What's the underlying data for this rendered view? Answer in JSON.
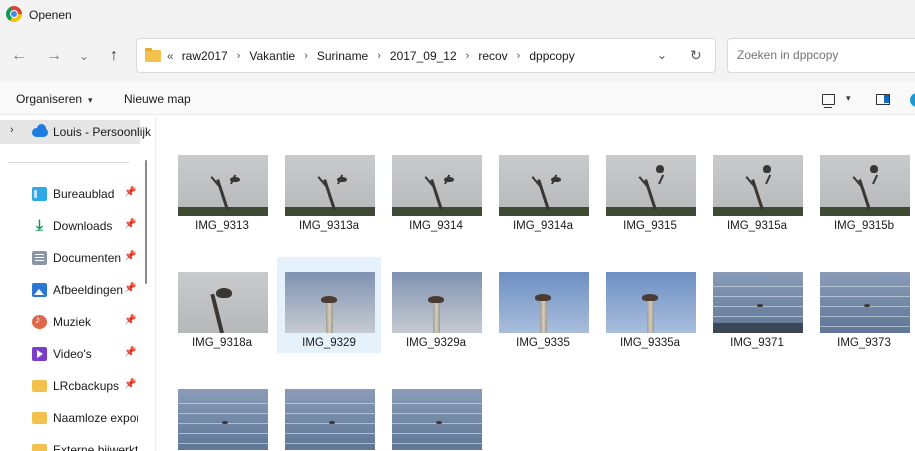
{
  "window": {
    "title": "Openen"
  },
  "nav": {
    "back_icon": "←",
    "forward_icon": "→",
    "recent_icon": "⌄",
    "up_icon": "↑"
  },
  "address": {
    "overflow": "«",
    "crumbs": [
      "raw2017",
      "Vakantie",
      "Suriname",
      "2017_09_12",
      "recov",
      "dppcopy"
    ],
    "separator": "›",
    "chevron": "⌄",
    "refresh": "↻"
  },
  "search": {
    "placeholder": "Zoeken in dppcopy"
  },
  "toolbar": {
    "organize_label": "Organiseren",
    "organize_arrow": "▾",
    "new_folder_label": "Nieuwe map",
    "view_arrow": "▾"
  },
  "sidebar": {
    "onedrive_label": "Louis - Persoonlijk",
    "chevron": "›",
    "pin": "📌",
    "items": [
      {
        "label": "Bureaublad",
        "icon": "desktop-icon",
        "pinned": true
      },
      {
        "label": "Downloads",
        "icon": "download-icon",
        "glyph": "⤓",
        "pinned": true
      },
      {
        "label": "Documenten",
        "icon": "documents-icon",
        "pinned": true
      },
      {
        "label": "Afbeeldingen",
        "icon": "pictures-icon",
        "pinned": true
      },
      {
        "label": "Muziek",
        "icon": "music-icon",
        "pinned": true
      },
      {
        "label": "Video's",
        "icon": "video-icon",
        "pinned": true
      },
      {
        "label": "LRcbackups",
        "icon": "folder-icon",
        "pinned": true
      },
      {
        "label": "Naamloze export",
        "icon": "folder-icon",
        "pinned": false
      },
      {
        "label": "Externe bijwerkt",
        "icon": "folder-icon",
        "pinned": false
      }
    ]
  },
  "files": [
    {
      "name": "IMG_9313"
    },
    {
      "name": "IMG_9313a"
    },
    {
      "name": "IMG_9314"
    },
    {
      "name": "IMG_9314a"
    },
    {
      "name": "IMG_9315"
    },
    {
      "name": "IMG_9315a"
    },
    {
      "name": "IMG_9315b"
    },
    {
      "name": "IMG_9318a"
    },
    {
      "name": "IMG_9329",
      "selected": true
    },
    {
      "name": "IMG_9329a"
    },
    {
      "name": "IMG_9335"
    },
    {
      "name": "IMG_9335a"
    },
    {
      "name": "IMG_9371"
    },
    {
      "name": "IMG_9373"
    },
    {
      "name": ""
    },
    {
      "name": ""
    },
    {
      "name": ""
    }
  ]
}
